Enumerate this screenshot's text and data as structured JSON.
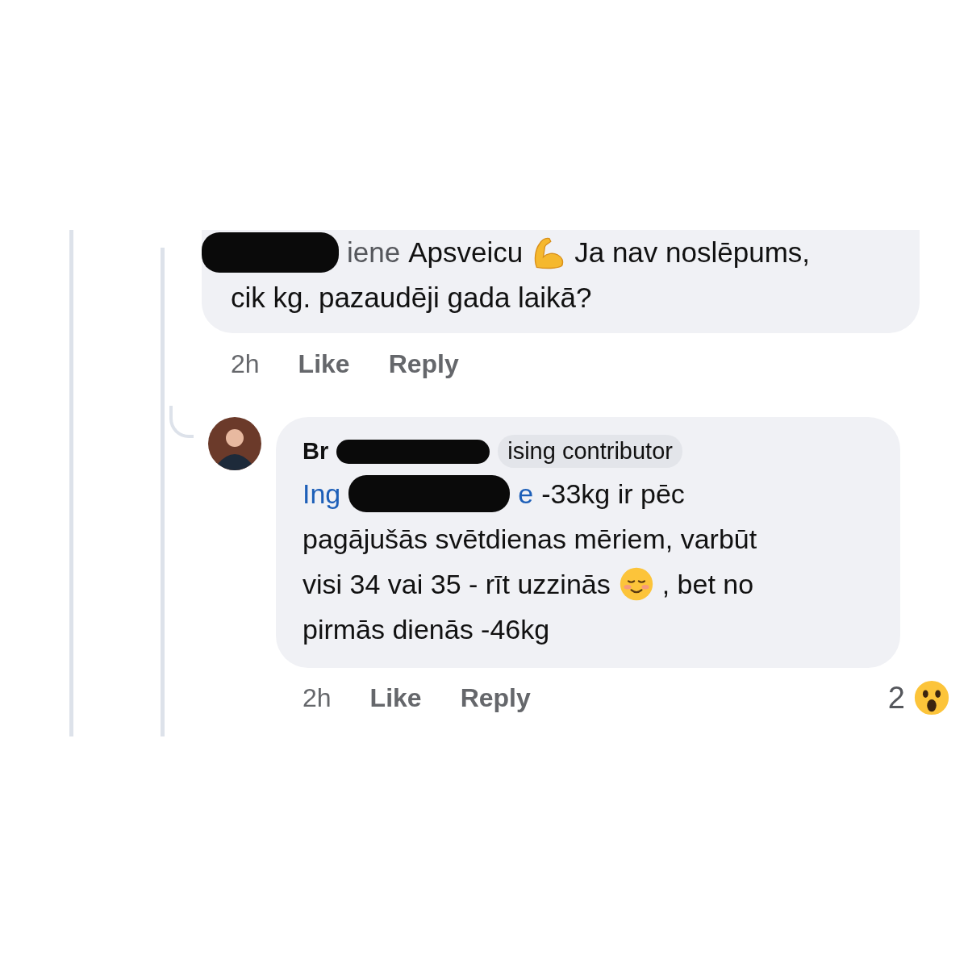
{
  "comments": [
    {
      "lines": [
        [
          {
            "kind": "redaction"
          },
          {
            "kind": "mention",
            "text": "iene"
          },
          {
            "kind": "text",
            "text": "Apsveicu"
          },
          {
            "kind": "flexed-arm"
          },
          {
            "kind": "text",
            "text": "Ja nav noslēpums,"
          }
        ],
        [
          {
            "kind": "text",
            "text": "cik kg. pazaudēji gada laikā?"
          }
        ]
      ],
      "time": "2h",
      "actions": [
        "Like",
        "Reply"
      ]
    },
    {
      "author": "Br",
      "badge": "ising contributor",
      "lines": [
        [
          {
            "kind": "mention",
            "text": "Ing"
          },
          {
            "kind": "redaction"
          },
          {
            "kind": "mention",
            "text": "e"
          },
          {
            "kind": "text",
            "text": "-33kg ir pēc"
          }
        ],
        [
          {
            "kind": "text",
            "text": "pagājušās svētdienas mēriem, varbūt"
          }
        ],
        [
          {
            "kind": "text",
            "text": "visi 34 vai 35 - rīt uzzinās"
          },
          {
            "kind": "smiling"
          },
          {
            "kind": "text",
            "text": ", bet no"
          }
        ],
        [
          {
            "kind": "text",
            "text": "pirmās dienās -46kg"
          }
        ]
      ],
      "time": "2h",
      "actions": [
        "Like",
        "Reply"
      ],
      "reactions": {
        "count": "2",
        "kind": "wow"
      }
    }
  ]
}
